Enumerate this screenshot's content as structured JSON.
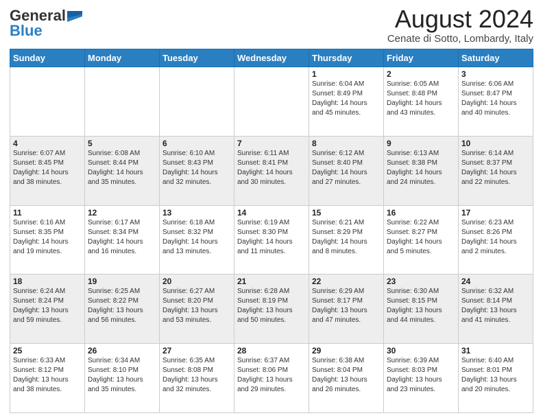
{
  "logo": {
    "general": "General",
    "blue": "Blue"
  },
  "title": "August 2024",
  "location": "Cenate di Sotto, Lombardy, Italy",
  "days_of_week": [
    "Sunday",
    "Monday",
    "Tuesday",
    "Wednesday",
    "Thursday",
    "Friday",
    "Saturday"
  ],
  "weeks": [
    [
      {
        "day": "",
        "info": ""
      },
      {
        "day": "",
        "info": ""
      },
      {
        "day": "",
        "info": ""
      },
      {
        "day": "",
        "info": ""
      },
      {
        "day": "1",
        "info": "Sunrise: 6:04 AM\nSunset: 8:49 PM\nDaylight: 14 hours\nand 45 minutes."
      },
      {
        "day": "2",
        "info": "Sunrise: 6:05 AM\nSunset: 8:48 PM\nDaylight: 14 hours\nand 43 minutes."
      },
      {
        "day": "3",
        "info": "Sunrise: 6:06 AM\nSunset: 8:47 PM\nDaylight: 14 hours\nand 40 minutes."
      }
    ],
    [
      {
        "day": "4",
        "info": "Sunrise: 6:07 AM\nSunset: 8:45 PM\nDaylight: 14 hours\nand 38 minutes."
      },
      {
        "day": "5",
        "info": "Sunrise: 6:08 AM\nSunset: 8:44 PM\nDaylight: 14 hours\nand 35 minutes."
      },
      {
        "day": "6",
        "info": "Sunrise: 6:10 AM\nSunset: 8:43 PM\nDaylight: 14 hours\nand 32 minutes."
      },
      {
        "day": "7",
        "info": "Sunrise: 6:11 AM\nSunset: 8:41 PM\nDaylight: 14 hours\nand 30 minutes."
      },
      {
        "day": "8",
        "info": "Sunrise: 6:12 AM\nSunset: 8:40 PM\nDaylight: 14 hours\nand 27 minutes."
      },
      {
        "day": "9",
        "info": "Sunrise: 6:13 AM\nSunset: 8:38 PM\nDaylight: 14 hours\nand 24 minutes."
      },
      {
        "day": "10",
        "info": "Sunrise: 6:14 AM\nSunset: 8:37 PM\nDaylight: 14 hours\nand 22 minutes."
      }
    ],
    [
      {
        "day": "11",
        "info": "Sunrise: 6:16 AM\nSunset: 8:35 PM\nDaylight: 14 hours\nand 19 minutes."
      },
      {
        "day": "12",
        "info": "Sunrise: 6:17 AM\nSunset: 8:34 PM\nDaylight: 14 hours\nand 16 minutes."
      },
      {
        "day": "13",
        "info": "Sunrise: 6:18 AM\nSunset: 8:32 PM\nDaylight: 14 hours\nand 13 minutes."
      },
      {
        "day": "14",
        "info": "Sunrise: 6:19 AM\nSunset: 8:30 PM\nDaylight: 14 hours\nand 11 minutes."
      },
      {
        "day": "15",
        "info": "Sunrise: 6:21 AM\nSunset: 8:29 PM\nDaylight: 14 hours\nand 8 minutes."
      },
      {
        "day": "16",
        "info": "Sunrise: 6:22 AM\nSunset: 8:27 PM\nDaylight: 14 hours\nand 5 minutes."
      },
      {
        "day": "17",
        "info": "Sunrise: 6:23 AM\nSunset: 8:26 PM\nDaylight: 14 hours\nand 2 minutes."
      }
    ],
    [
      {
        "day": "18",
        "info": "Sunrise: 6:24 AM\nSunset: 8:24 PM\nDaylight: 13 hours\nand 59 minutes."
      },
      {
        "day": "19",
        "info": "Sunrise: 6:25 AM\nSunset: 8:22 PM\nDaylight: 13 hours\nand 56 minutes."
      },
      {
        "day": "20",
        "info": "Sunrise: 6:27 AM\nSunset: 8:20 PM\nDaylight: 13 hours\nand 53 minutes."
      },
      {
        "day": "21",
        "info": "Sunrise: 6:28 AM\nSunset: 8:19 PM\nDaylight: 13 hours\nand 50 minutes."
      },
      {
        "day": "22",
        "info": "Sunrise: 6:29 AM\nSunset: 8:17 PM\nDaylight: 13 hours\nand 47 minutes."
      },
      {
        "day": "23",
        "info": "Sunrise: 6:30 AM\nSunset: 8:15 PM\nDaylight: 13 hours\nand 44 minutes."
      },
      {
        "day": "24",
        "info": "Sunrise: 6:32 AM\nSunset: 8:14 PM\nDaylight: 13 hours\nand 41 minutes."
      }
    ],
    [
      {
        "day": "25",
        "info": "Sunrise: 6:33 AM\nSunset: 8:12 PM\nDaylight: 13 hours\nand 38 minutes."
      },
      {
        "day": "26",
        "info": "Sunrise: 6:34 AM\nSunset: 8:10 PM\nDaylight: 13 hours\nand 35 minutes."
      },
      {
        "day": "27",
        "info": "Sunrise: 6:35 AM\nSunset: 8:08 PM\nDaylight: 13 hours\nand 32 minutes."
      },
      {
        "day": "28",
        "info": "Sunrise: 6:37 AM\nSunset: 8:06 PM\nDaylight: 13 hours\nand 29 minutes."
      },
      {
        "day": "29",
        "info": "Sunrise: 6:38 AM\nSunset: 8:04 PM\nDaylight: 13 hours\nand 26 minutes."
      },
      {
        "day": "30",
        "info": "Sunrise: 6:39 AM\nSunset: 8:03 PM\nDaylight: 13 hours\nand 23 minutes."
      },
      {
        "day": "31",
        "info": "Sunrise: 6:40 AM\nSunset: 8:01 PM\nDaylight: 13 hours\nand 20 minutes."
      }
    ]
  ]
}
